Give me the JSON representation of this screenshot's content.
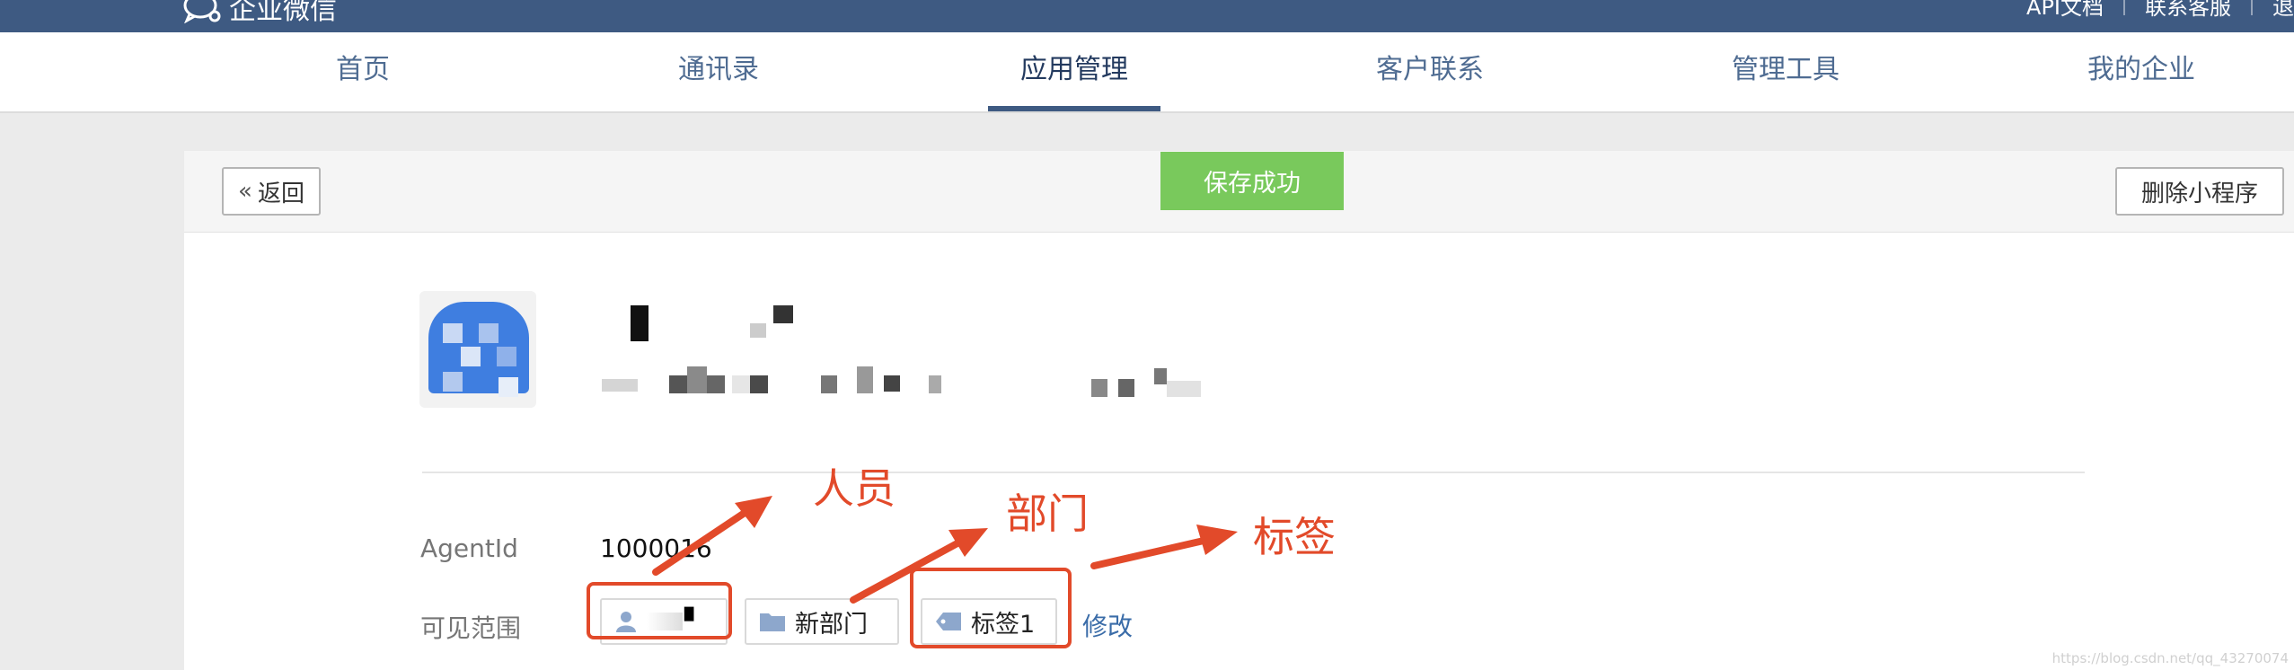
{
  "header": {
    "logo_text": "企业微信",
    "links": [
      "API文档",
      "联系客服",
      "退"
    ]
  },
  "nav": {
    "items": [
      "首页",
      "通讯录",
      "应用管理",
      "客户联系",
      "管理工具",
      "我的企业"
    ],
    "active_index": 2
  },
  "toolbar": {
    "back_label": "返回",
    "toast": "保存成功",
    "delete_label": "删除小程序"
  },
  "app": {
    "agentid_label": "AgentId",
    "agentid_value": "1000016",
    "visible_label": "可见范围",
    "chips": [
      {
        "type": "person",
        "label": "▘"
      },
      {
        "type": "department",
        "label": "新部门"
      },
      {
        "type": "tag",
        "label": "标签1"
      }
    ],
    "edit_label": "修改"
  },
  "annotations": {
    "person": "人员",
    "department": "部门",
    "tag": "标签"
  },
  "watermark": "https://blog.csdn.net/qq_43270074",
  "colors": {
    "topbar": "#3e5a82",
    "toast": "#79c95c",
    "annotation": "#e24a2a",
    "link": "#3a6ca8"
  }
}
